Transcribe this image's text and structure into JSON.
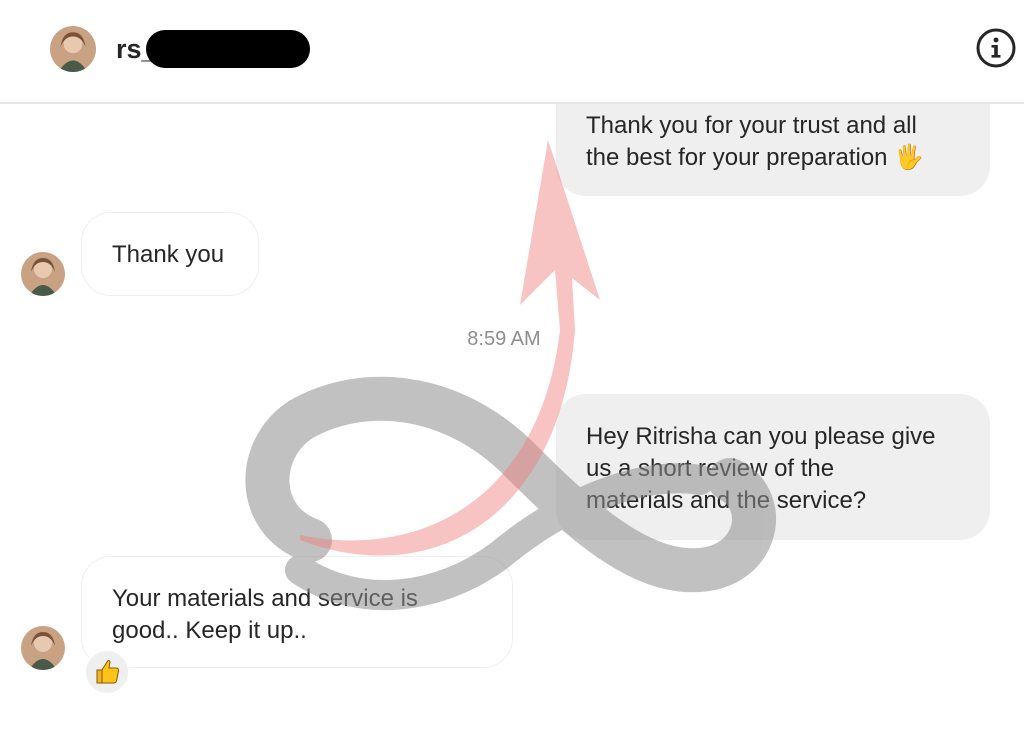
{
  "header": {
    "contact_name": "rs_",
    "info_icon": "info-circle-icon"
  },
  "messages": [
    {
      "direction": "outgoing",
      "lines": [
        "Thank you for your trust and all",
        "the best for your preparation 🖐"
      ]
    },
    {
      "direction": "incoming",
      "lines": [
        "Thank you"
      ]
    },
    {
      "direction": "outgoing",
      "lines": [
        "Hey Ritrisha can you please give",
        "us a short review of the",
        "materials and the service?"
      ]
    },
    {
      "direction": "incoming",
      "lines": [
        "Your materials and service is",
        "good.. Keep it up.."
      ],
      "reaction": "👍"
    }
  ],
  "timestamp": "8:59 AM",
  "colors": {
    "outgoing_bubble": "#efefef",
    "incoming_border": "#efefef",
    "timestamp": "#8e8e8e",
    "watermark_red": "#f2a0a0",
    "watermark_gray": "#9a9a9a"
  }
}
